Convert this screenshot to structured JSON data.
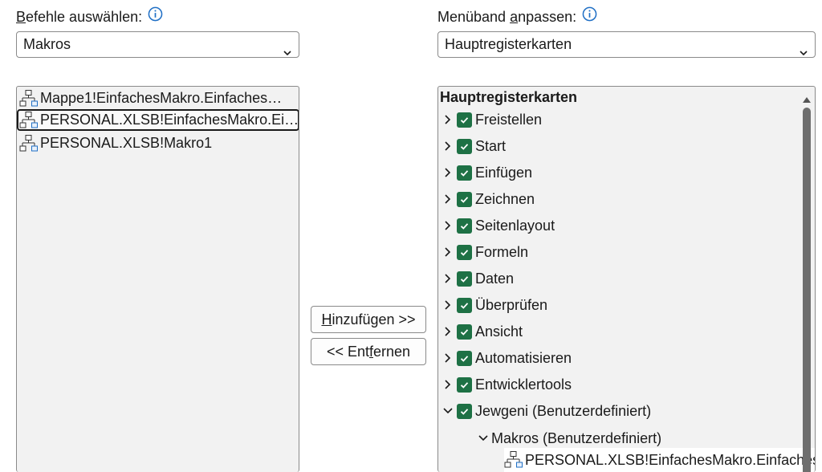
{
  "left": {
    "label_prefix": "",
    "label_hotkey": "B",
    "label_rest": "efehle auswählen:",
    "dropdown_value": "Makros",
    "commands": [
      "Mappe1!EinfachesMakro.Einfaches…",
      "PERSONAL.XLSB!EinfachesMakro.Ei…",
      "PERSONAL.XLSB!Makro1"
    ]
  },
  "right": {
    "label_prefix": "Menüband ",
    "label_hotkey": "a",
    "label_rest": "npassen:",
    "dropdown_value": "Hauptregisterkarten",
    "tree_title": "Hauptregisterkarten",
    "tabs": [
      "Freistellen",
      "Start",
      "Einfügen",
      "Zeichnen",
      "Seitenlayout",
      "Formeln",
      "Daten",
      "Überprüfen",
      "Ansicht",
      "Automatisieren",
      "Entwicklertools",
      "Jewgeni (Benutzerdefiniert)"
    ],
    "group": "Makros (Benutzerdefiniert)",
    "group_item": "PERSONAL.XLSB!EinfachesMakro.Einfaches"
  },
  "buttons": {
    "add_hotkey": "H",
    "add_rest": "inzufügen >>",
    "remove_prefix": "<< Ent",
    "remove_hotkey": "f",
    "remove_rest": "ernen"
  },
  "colors": {
    "checkbox": "#1e7145",
    "info_icon": "#1f6fc5",
    "list_bg": "#f2f2f2"
  }
}
